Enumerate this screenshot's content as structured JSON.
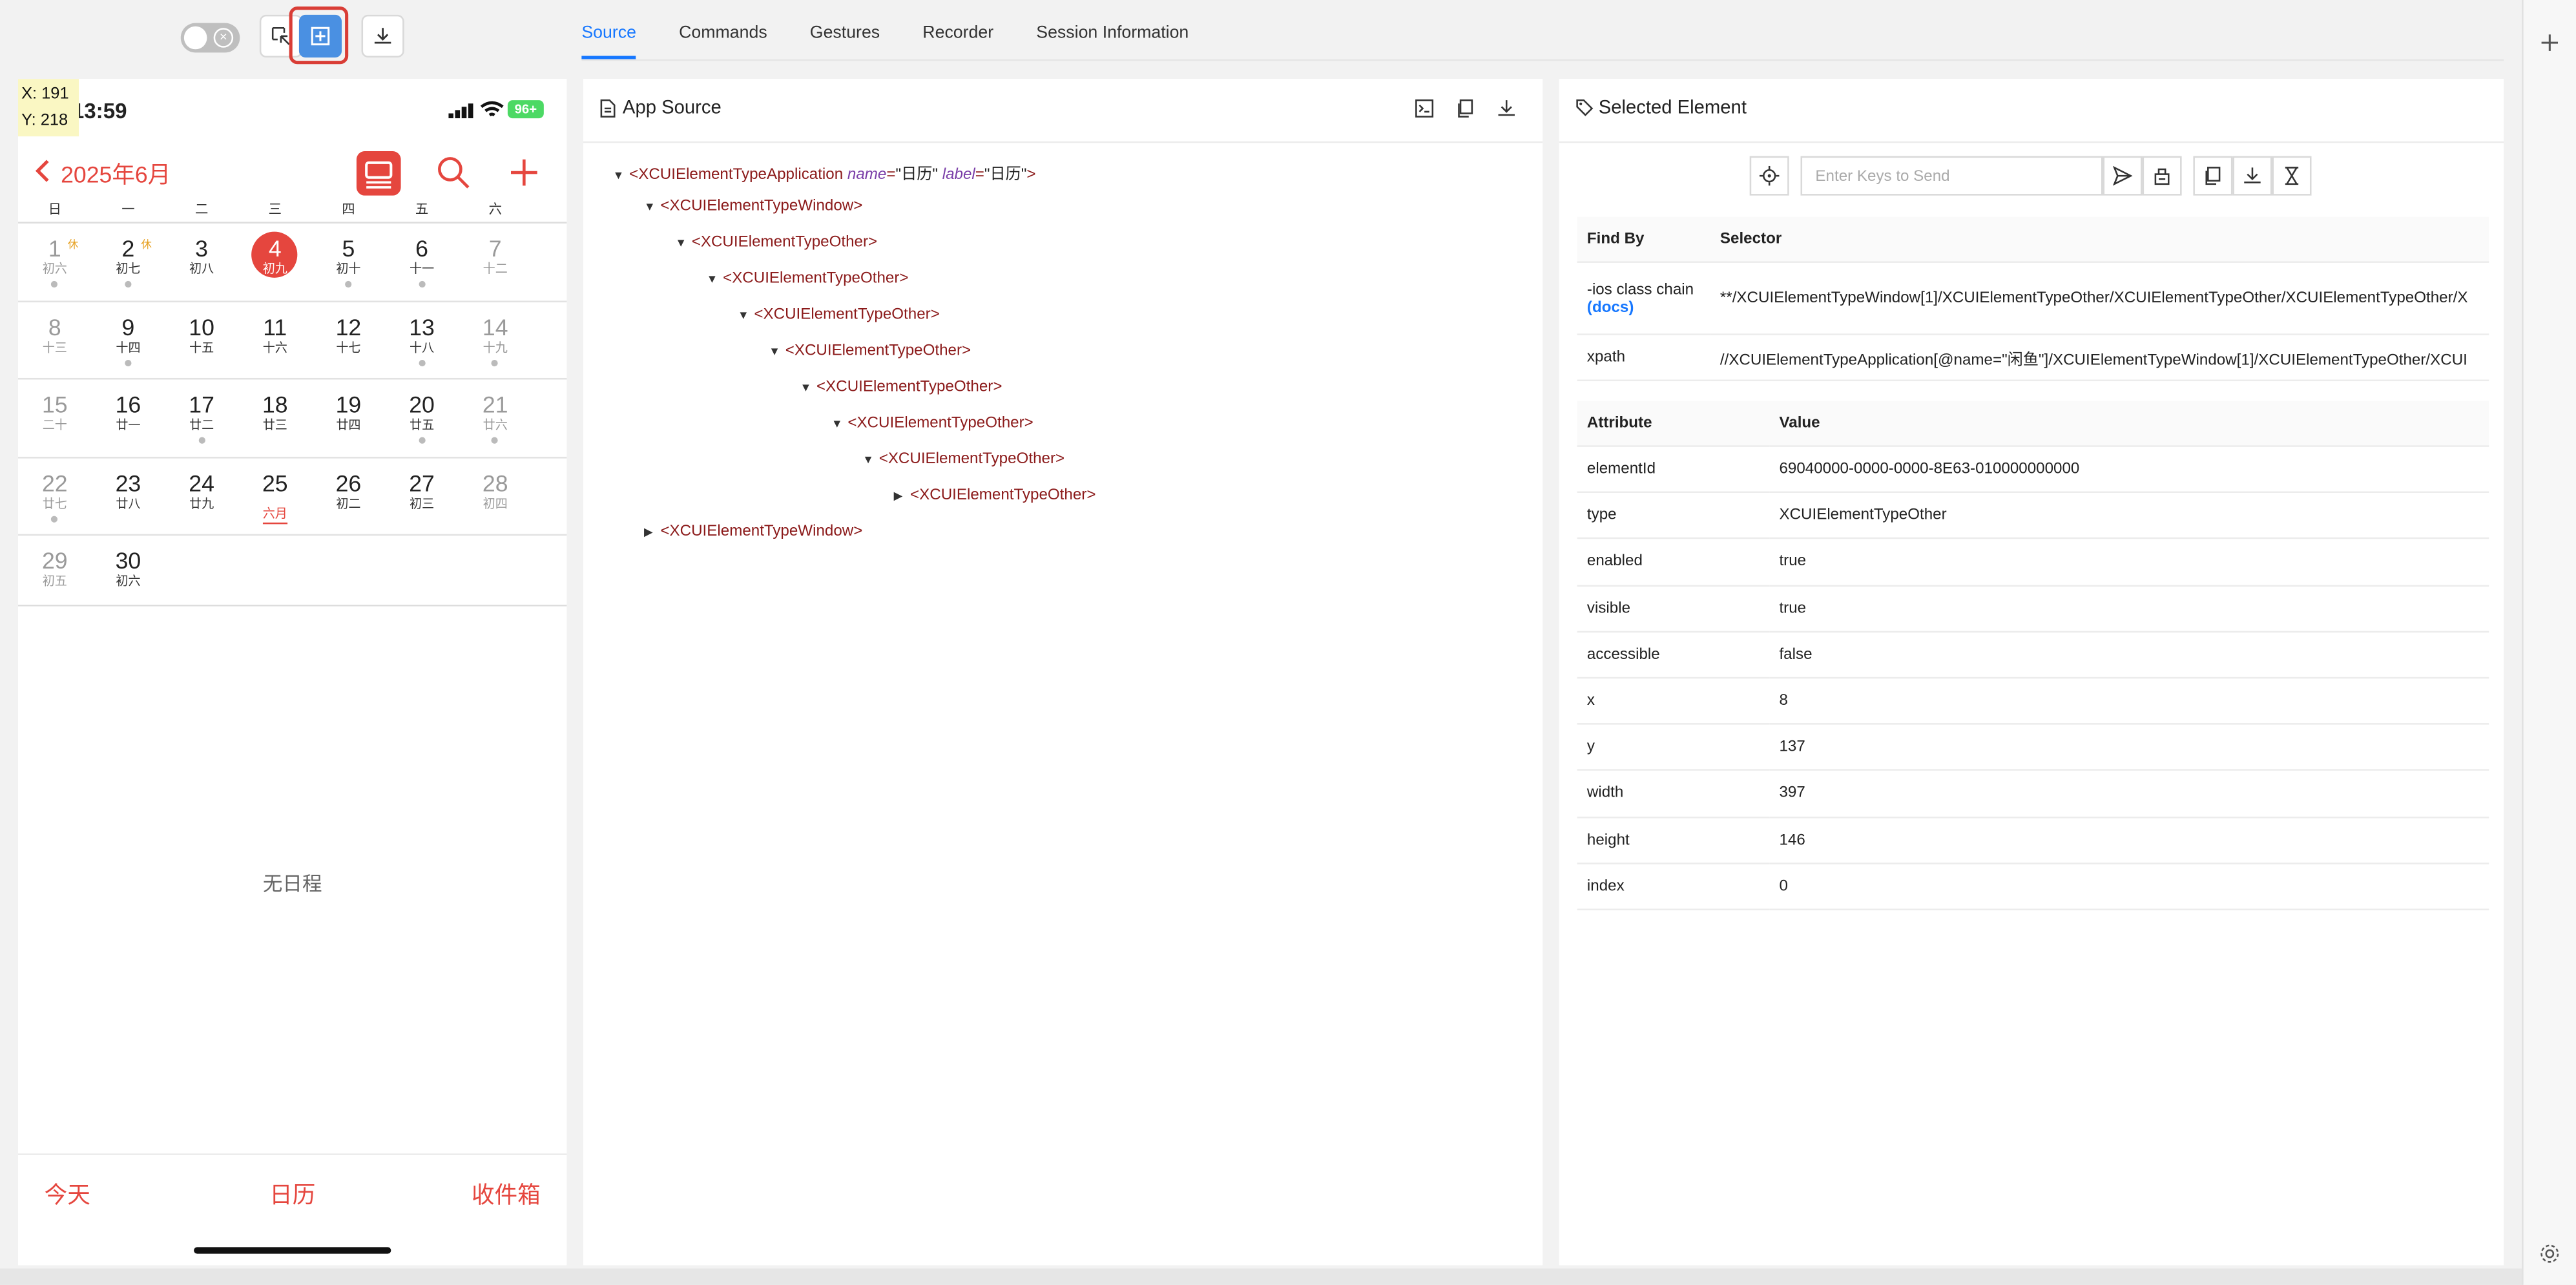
{
  "toolbar": {
    "toggle_icon": "close-circle-icon",
    "buttons": [
      "select-icon",
      "tap-icon",
      "download-icon"
    ]
  },
  "tabs": [
    "Source",
    "Commands",
    "Gestures",
    "Recorder",
    "Session Information"
  ],
  "phone": {
    "coords": {
      "x": "X: 191",
      "y": "Y: 218"
    },
    "time": "13:59",
    "battery": "96+",
    "month": "2025年6月",
    "weekdays": [
      "日",
      "一",
      "二",
      "三",
      "四",
      "五",
      "六"
    ],
    "weeks": [
      [
        {
          "n": "1",
          "l": "初六",
          "w": true,
          "hol": "休",
          "dot": true
        },
        {
          "n": "2",
          "l": "初七",
          "hol": "休",
          "dot": true
        },
        {
          "n": "3",
          "l": "初八"
        },
        {
          "n": "4",
          "l": "初九",
          "today": true
        },
        {
          "n": "5",
          "l": "初十",
          "dot": true
        },
        {
          "n": "6",
          "l": "十一",
          "dot": true
        },
        {
          "n": "7",
          "l": "十二",
          "w": true
        }
      ],
      [
        {
          "n": "8",
          "l": "十三",
          "w": true
        },
        {
          "n": "9",
          "l": "十四",
          "dot": true
        },
        {
          "n": "10",
          "l": "十五"
        },
        {
          "n": "11",
          "l": "十六"
        },
        {
          "n": "12",
          "l": "十七"
        },
        {
          "n": "13",
          "l": "十八",
          "dot": true
        },
        {
          "n": "14",
          "l": "十九",
          "w": true,
          "dot": true
        }
      ],
      [
        {
          "n": "15",
          "l": "二十",
          "w": true
        },
        {
          "n": "16",
          "l": "廿一"
        },
        {
          "n": "17",
          "l": "廿二",
          "dot": true
        },
        {
          "n": "18",
          "l": "廿三"
        },
        {
          "n": "19",
          "l": "廿四"
        },
        {
          "n": "20",
          "l": "廿五",
          "dot": true
        },
        {
          "n": "21",
          "l": "廿六",
          "w": true,
          "dot": true
        }
      ],
      [
        {
          "n": "22",
          "l": "廿七",
          "w": true,
          "dot": true
        },
        {
          "n": "23",
          "l": "廿八"
        },
        {
          "n": "24",
          "l": "廿九"
        },
        {
          "n": "25",
          "l": "六月",
          "sel": true
        },
        {
          "n": "26",
          "l": "初二"
        },
        {
          "n": "27",
          "l": "初三"
        },
        {
          "n": "28",
          "l": "初四",
          "w": true
        }
      ],
      [
        {
          "n": "29",
          "l": "初五",
          "w": true
        },
        {
          "n": "30",
          "l": "初六"
        }
      ]
    ],
    "empty": "无日程",
    "tabbar": [
      "今天",
      "日历",
      "收件箱"
    ]
  },
  "source": {
    "title": "App Source",
    "nodes": [
      {
        "caret": "▼",
        "tag": "<XCUIElementTypeApplication",
        "attrs": [
          {
            "k": "name",
            "v": "\"日历\""
          },
          {
            "k": "label",
            "v": "\"日历\""
          }
        ],
        "end": ">"
      },
      {
        "caret": "▼",
        "tag": "<XCUIElementTypeWindow>"
      },
      {
        "caret": "▼",
        "tag": "<XCUIElementTypeOther>"
      },
      {
        "caret": "▼",
        "tag": "<XCUIElementTypeOther>"
      },
      {
        "caret": "▼",
        "tag": "<XCUIElementTypeOther>"
      },
      {
        "caret": "▼",
        "tag": "<XCUIElementTypeOther>"
      },
      {
        "caret": "▼",
        "tag": "<XCUIElementTypeOther>"
      },
      {
        "caret": "▼",
        "tag": "<XCUIElementTypeOther>"
      },
      {
        "caret": "▼",
        "tag": "<XCUIElementTypeOther>"
      },
      {
        "caret": "▶",
        "tag": "<XCUIElementTypeOther>"
      },
      {
        "caret": "▶",
        "tag": "<XCUIElementTypeWindow>"
      }
    ]
  },
  "selected": {
    "title": "Selected Element",
    "keys_placeholder": "Enter Keys to Send",
    "findby_headers": [
      "Find By",
      "Selector"
    ],
    "findby": [
      {
        "by": "-ios class chain",
        "docs": "(docs)",
        "selector": "**/XCUIElementTypeWindow[1]/XCUIElementTypeOther/XCUIElementTypeOther/XCUIElementTypeOther/X"
      },
      {
        "by": "xpath",
        "selector": "//XCUIElementTypeApplication[@name=\"闲鱼\"]/XCUIElementTypeWindow[1]/XCUIElementTypeOther/XCUI"
      }
    ],
    "attr_headers": [
      "Attribute",
      "Value"
    ],
    "attributes": [
      {
        "k": "elementId",
        "v": "69040000-0000-0000-8E63-010000000000"
      },
      {
        "k": "type",
        "v": "XCUIElementTypeOther"
      },
      {
        "k": "enabled",
        "v": "true"
      },
      {
        "k": "visible",
        "v": "true"
      },
      {
        "k": "accessible",
        "v": "false"
      },
      {
        "k": "x",
        "v": "8"
      },
      {
        "k": "y",
        "v": "137"
      },
      {
        "k": "width",
        "v": "397"
      },
      {
        "k": "height",
        "v": "146"
      },
      {
        "k": "index",
        "v": "0"
      }
    ]
  }
}
